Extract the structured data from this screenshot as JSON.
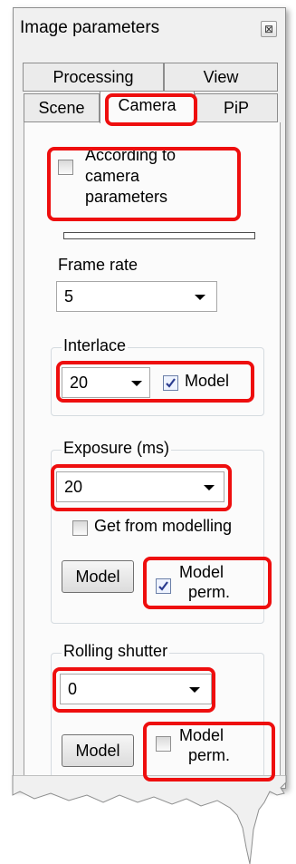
{
  "window": {
    "title": "Image parameters",
    "close_glyph": "⊠"
  },
  "tabs": {
    "row1": [
      "Processing",
      "View"
    ],
    "row2": [
      "Scene",
      "Camera",
      "PiP"
    ],
    "active": "Camera"
  },
  "camera": {
    "according_label": "According to camera parameters",
    "according_lines": [
      "According to",
      "camera",
      "parameters"
    ],
    "according_checked": false,
    "frame_rate": {
      "label": "Frame rate",
      "value": "5"
    },
    "interlace": {
      "legend": "Interlace",
      "value": "20",
      "model_label": "Model",
      "model_checked": true
    },
    "exposure": {
      "legend": "Exposure (ms)",
      "value": "20",
      "get_from_modelling_label": "Get from modelling",
      "get_from_modelling_checked": false,
      "model_button": "Model",
      "model_perm_lines": [
        "Model",
        "perm."
      ],
      "model_perm_checked": true
    },
    "rolling_shutter": {
      "legend": "Rolling shutter",
      "value": "0",
      "model_button": "Model",
      "model_perm_lines": [
        "Model",
        "perm."
      ],
      "model_perm_checked": false
    }
  },
  "colors": {
    "highlight": "#ee0e0e",
    "panel_bg": "#f0f0f0",
    "content_bg": "#fbfbfb"
  }
}
